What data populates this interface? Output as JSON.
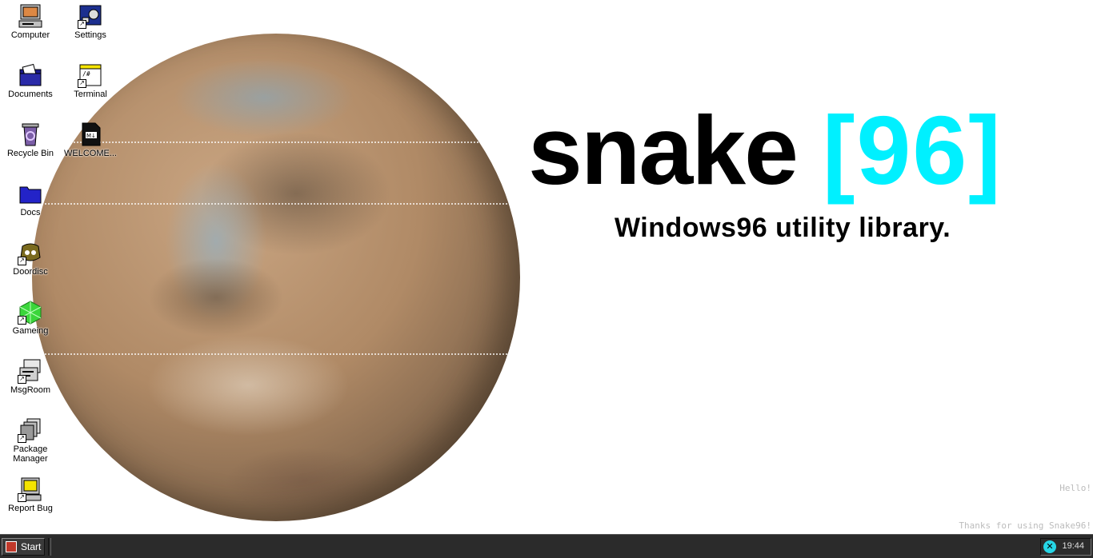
{
  "desktop_icons": [
    {
      "id": "computer",
      "label": "Computer",
      "icon": "computer-icon"
    },
    {
      "id": "settings",
      "label": "Settings",
      "icon": "settings-icon"
    },
    {
      "id": "documents",
      "label": "Documents",
      "icon": "documents-folder-icon"
    },
    {
      "id": "terminal",
      "label": "Terminal",
      "icon": "terminal-icon"
    },
    {
      "id": "recycle",
      "label": "Recycle Bin",
      "icon": "recycle-bin-icon"
    },
    {
      "id": "welcome",
      "label": "WELCOME...",
      "icon": "markdown-file-icon"
    },
    {
      "id": "docs",
      "label": "Docs",
      "icon": "folder-icon"
    },
    {
      "id": "doordisc",
      "label": "Doordisc",
      "icon": "doordisc-icon"
    },
    {
      "id": "gameing",
      "label": "Gameing",
      "icon": "gaming-cube-icon"
    },
    {
      "id": "msgroom",
      "label": "MsgRoom",
      "icon": "msgroom-icon"
    },
    {
      "id": "package",
      "label": "Package Manager",
      "icon": "package-manager-icon"
    },
    {
      "id": "reportbug",
      "label": "Report Bug",
      "icon": "report-bug-icon"
    }
  ],
  "wallpaper": {
    "title_main": "snake",
    "title_accent": "[96]",
    "subtitle": "Windows96 utility library.",
    "accent_color": "#00f0ff",
    "log_hello": "Hello!",
    "log_thanks": "Thanks for using Snake96!"
  },
  "taskbar": {
    "start_label": "Start",
    "start_icon": "windows96-logo-icon",
    "tray_icon": "snake96-tray-icon",
    "clock": "19:44"
  }
}
